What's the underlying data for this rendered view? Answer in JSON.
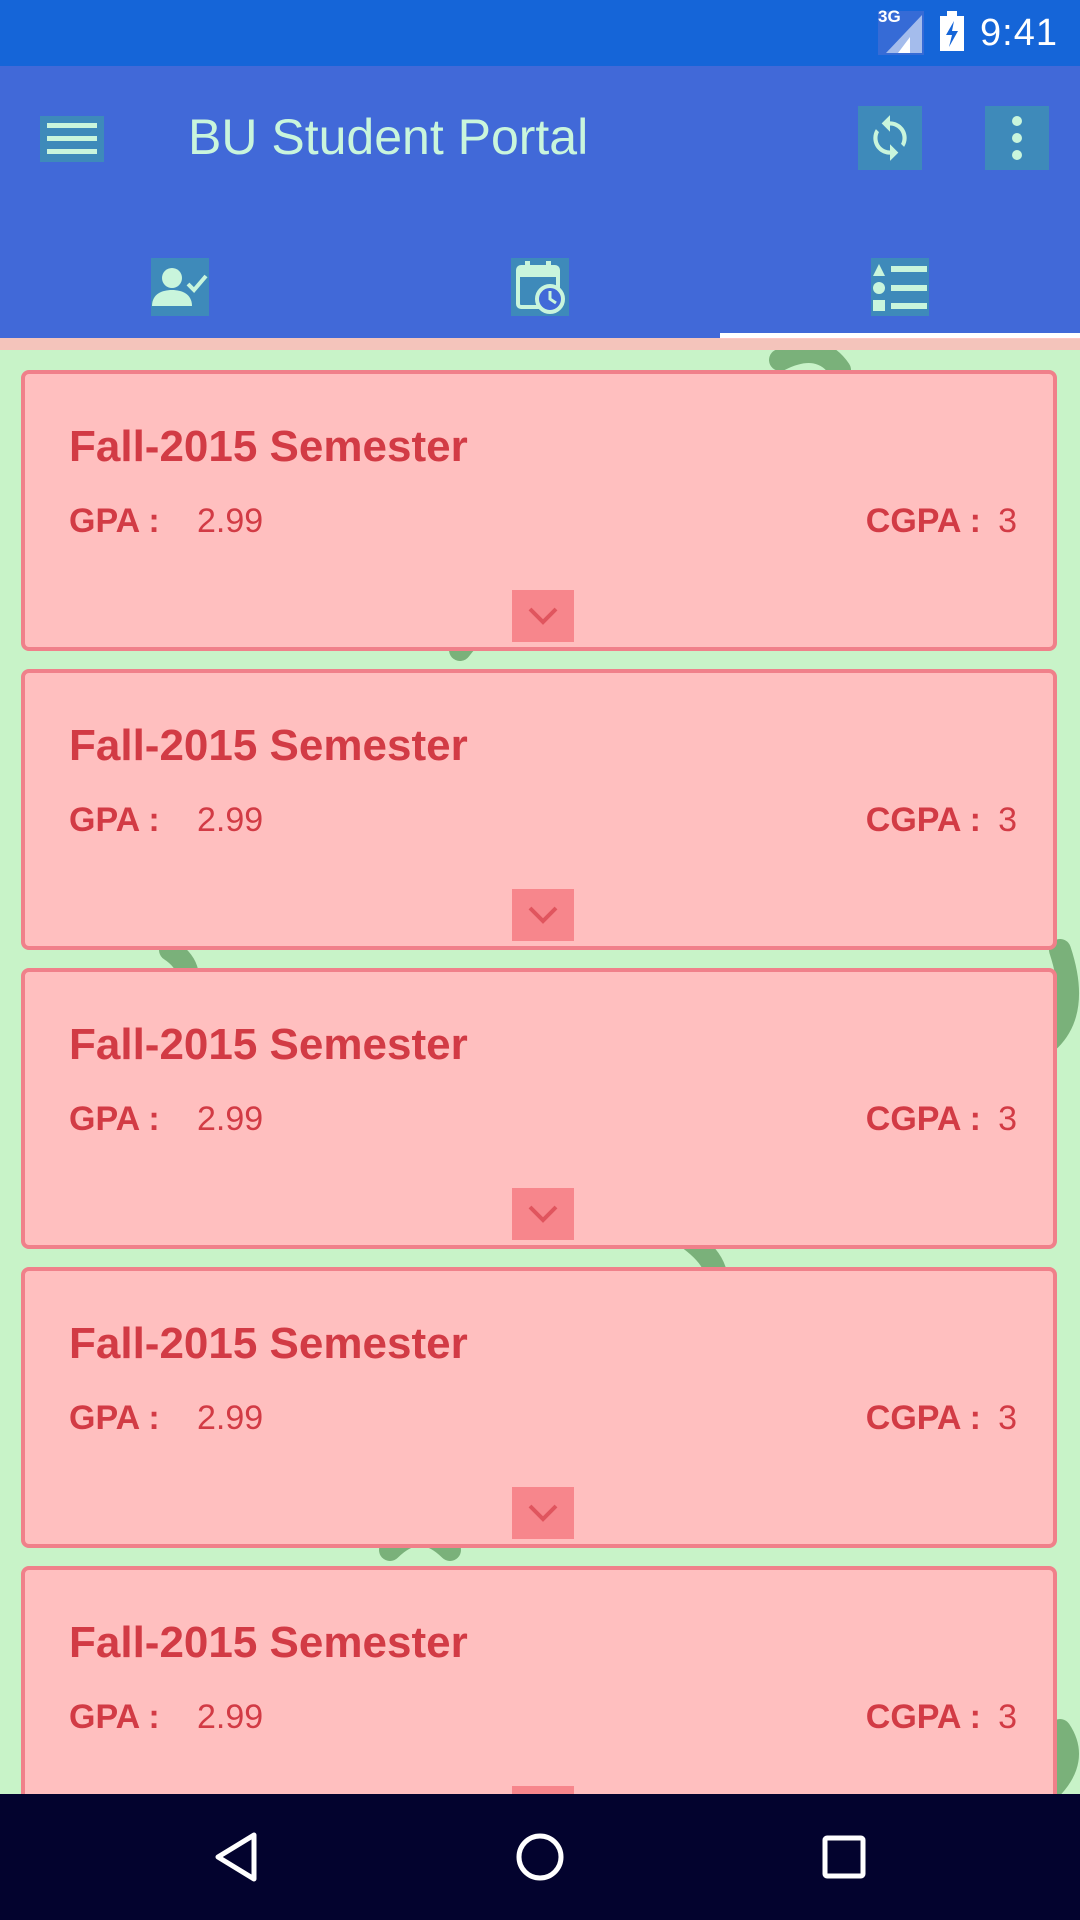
{
  "status_bar": {
    "network_label": "3G",
    "time": "9:41",
    "icons": [
      "signal-icon",
      "battery-charging-icon"
    ]
  },
  "app_bar": {
    "title": "BU Student Portal",
    "icons": [
      "menu-icon",
      "refresh-icon",
      "more-vert-icon"
    ]
  },
  "tabs": [
    {
      "icon": "person-check-icon",
      "selected": false
    },
    {
      "icon": "calendar-clock-icon",
      "selected": false
    },
    {
      "icon": "list-icon",
      "selected": true
    }
  ],
  "semesters": [
    {
      "title": "Fall-2015 Semester",
      "gpa_label": "GPA :",
      "gpa": "2.99",
      "cgpa_label": "CGPA :",
      "cgpa": "3"
    },
    {
      "title": "Fall-2015 Semester",
      "gpa_label": "GPA :",
      "gpa": "2.99",
      "cgpa_label": "CGPA :",
      "cgpa": "3"
    },
    {
      "title": "Fall-2015 Semester",
      "gpa_label": "GPA :",
      "gpa": "2.99",
      "cgpa_label": "CGPA :",
      "cgpa": "3"
    },
    {
      "title": "Fall-2015 Semester",
      "gpa_label": "GPA :",
      "gpa": "2.99",
      "cgpa_label": "CGPA :",
      "cgpa": "3"
    },
    {
      "title": "Fall-2015 Semester",
      "gpa_label": "GPA :",
      "gpa": "2.99",
      "cgpa_label": "CGPA :",
      "cgpa": "3"
    }
  ],
  "nav_bar": {
    "icons": [
      "back-icon",
      "home-icon",
      "recents-icon"
    ]
  },
  "colors": {
    "status_bar": "#1565d8",
    "app_bar": "#4169d8",
    "background": "#c8f3c8",
    "card": "#ffbfbf",
    "card_text": "#d23b45",
    "nav_bar": "#03032e"
  }
}
